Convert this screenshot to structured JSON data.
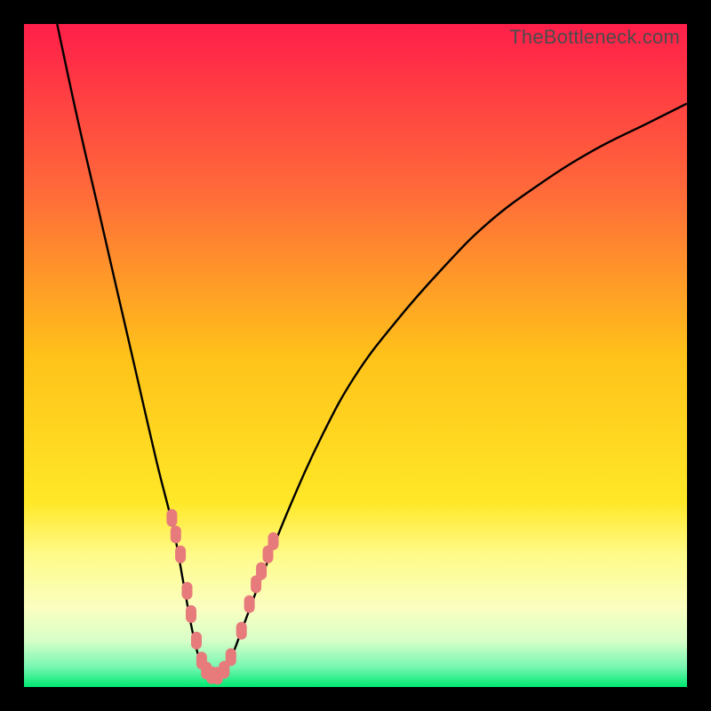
{
  "watermark": "TheBottleneck.com",
  "colors": {
    "black": "#000000",
    "curve": "#000000",
    "marker": "#e77b7c",
    "gradient_stops": [
      {
        "pos": 0.0,
        "color": "#ff1f4a"
      },
      {
        "pos": 0.25,
        "color": "#ff6a3a"
      },
      {
        "pos": 0.5,
        "color": "#ffc21a"
      },
      {
        "pos": 0.72,
        "color": "#ffe827"
      },
      {
        "pos": 0.8,
        "color": "#fffb8a"
      },
      {
        "pos": 0.88,
        "color": "#fbffc0"
      },
      {
        "pos": 0.93,
        "color": "#d8ffc8"
      },
      {
        "pos": 0.97,
        "color": "#77f7b2"
      },
      {
        "pos": 1.0,
        "color": "#00e971"
      }
    ]
  },
  "chart_data": {
    "type": "line",
    "title": "",
    "xlabel": "",
    "ylabel": "",
    "xlim": [
      0,
      100
    ],
    "ylim": [
      0,
      100
    ],
    "series": [
      {
        "name": "bottleneck-curve",
        "x": [
          5,
          8,
          11,
          14,
          17,
          20,
          22.5,
          24,
          25.5,
          27,
          29,
          31,
          33,
          36,
          40,
          45,
          50,
          56,
          63,
          70,
          78,
          86,
          94,
          100
        ],
        "y": [
          100,
          86,
          73,
          60,
          47,
          34,
          24,
          16,
          8,
          3,
          1.5,
          4,
          9,
          17,
          27,
          38,
          47,
          55,
          63,
          70,
          76,
          81,
          85,
          88
        ]
      }
    ],
    "markers": {
      "name": "highlight-dots",
      "color": "#e77b7c",
      "points": [
        {
          "x": 22.3,
          "y": 25.5
        },
        {
          "x": 22.9,
          "y": 23.0
        },
        {
          "x": 23.6,
          "y": 20.0
        },
        {
          "x": 24.6,
          "y": 14.5
        },
        {
          "x": 25.2,
          "y": 11.0
        },
        {
          "x": 26.0,
          "y": 7.0
        },
        {
          "x": 26.8,
          "y": 4.0
        },
        {
          "x": 27.5,
          "y": 2.5
        },
        {
          "x": 28.3,
          "y": 1.8
        },
        {
          "x": 29.2,
          "y": 1.7
        },
        {
          "x": 30.2,
          "y": 2.6
        },
        {
          "x": 31.2,
          "y": 4.5
        },
        {
          "x": 32.8,
          "y": 8.5
        },
        {
          "x": 34.0,
          "y": 12.5
        },
        {
          "x": 35.0,
          "y": 15.5
        },
        {
          "x": 35.8,
          "y": 17.5
        },
        {
          "x": 36.8,
          "y": 20.0
        },
        {
          "x": 37.6,
          "y": 22.0
        }
      ]
    }
  }
}
